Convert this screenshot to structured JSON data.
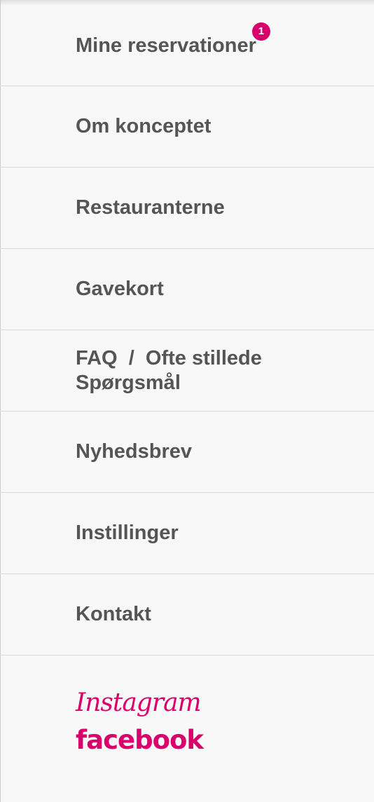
{
  "menu": {
    "items": [
      {
        "label": "Mine reservationer",
        "badge": "1"
      },
      {
        "label": "Om konceptet"
      },
      {
        "label": "Restauranterne"
      },
      {
        "label": "Gavekort"
      },
      {
        "label": "FAQ  /  Ofte stillede Spørgsmål"
      },
      {
        "label": "Nyhedsbrev"
      },
      {
        "label": "Instillinger"
      },
      {
        "label": "Kontakt"
      }
    ]
  },
  "social": {
    "instagram": "Instagram",
    "facebook": "facebook"
  },
  "colors": {
    "accent": "#d9006c",
    "text": "#555555",
    "background": "#f8f8f8",
    "divider": "#d9d9d9"
  }
}
